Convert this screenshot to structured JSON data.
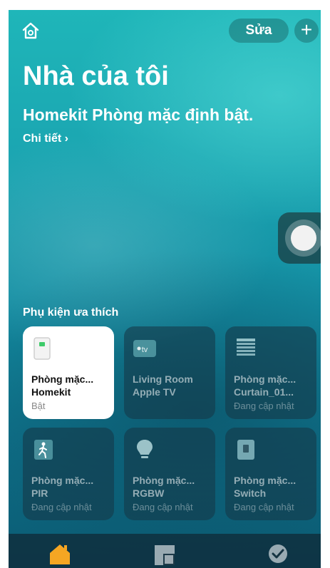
{
  "header": {
    "edit_label": "Sửa",
    "add_label": "+"
  },
  "home": {
    "title": "Nhà của tôi",
    "subtitle": "Homekit Phòng mặc định bật.",
    "details_link": "Chi tiết ›"
  },
  "favorites": {
    "section_title": "Phụ kiện ưa thích",
    "tiles": [
      {
        "line1": "Phòng mặc...",
        "line2": "Homekit",
        "status": "Bật",
        "icon": "outlet-icon",
        "state": "on"
      },
      {
        "line1": "Living Room",
        "line2": "Apple TV",
        "status": "",
        "icon": "apple-tv-icon",
        "state": "off"
      },
      {
        "line1": "Phòng mặc...",
        "line2": "Curtain_01...",
        "status": "Đang cập nhật",
        "icon": "curtain-icon",
        "state": "updating"
      },
      {
        "line1": "Phòng mặc...",
        "line2": "PIR",
        "status": "Đang cập nhật",
        "icon": "motion-sensor-icon",
        "state": "updating"
      },
      {
        "line1": "Phòng mặc...",
        "line2": "RGBW",
        "status": "Đang cập nhật",
        "icon": "lightbulb-icon",
        "state": "updating"
      },
      {
        "line1": "Phòng mặc...",
        "line2": "Switch",
        "status": "Đang cập nhật",
        "icon": "switch-icon",
        "state": "updating"
      }
    ]
  },
  "tabbar": {
    "items": [
      {
        "icon": "home-tab-icon",
        "active": true
      },
      {
        "icon": "rooms-tab-icon",
        "active": false
      },
      {
        "icon": "automation-tab-icon",
        "active": false
      }
    ],
    "active_color": "#f5a623"
  }
}
